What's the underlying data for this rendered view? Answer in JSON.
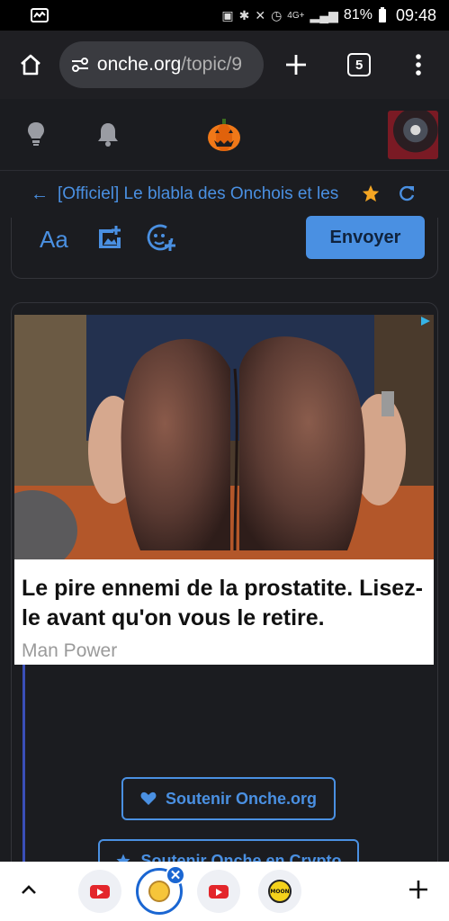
{
  "status": {
    "battery": "81%",
    "time": "09:48",
    "network": "4G+"
  },
  "browser": {
    "url_host": "onche.org",
    "url_path": "/topic/9",
    "tab_count": "5"
  },
  "topic": {
    "title": "[Officiel] Le blabla des Onchois et les",
    "arrow": "←"
  },
  "composer": {
    "format_label": "Aa",
    "send_label": "Envoyer"
  },
  "ad": {
    "title": "Le pire ennemi de la prostatite. Lisez-le avant qu'on vous le retire.",
    "source": "Man Power"
  },
  "buttons": {
    "support": "Soutenir Onche.org",
    "crypto": "Soutenir Onche en Crypto"
  },
  "tabstrip": {
    "close_symbol": "✕",
    "moon_label": "MOON"
  },
  "colors": {
    "accent": "#4a90e2",
    "background": "#1b1c20",
    "star": "#f5a623"
  }
}
